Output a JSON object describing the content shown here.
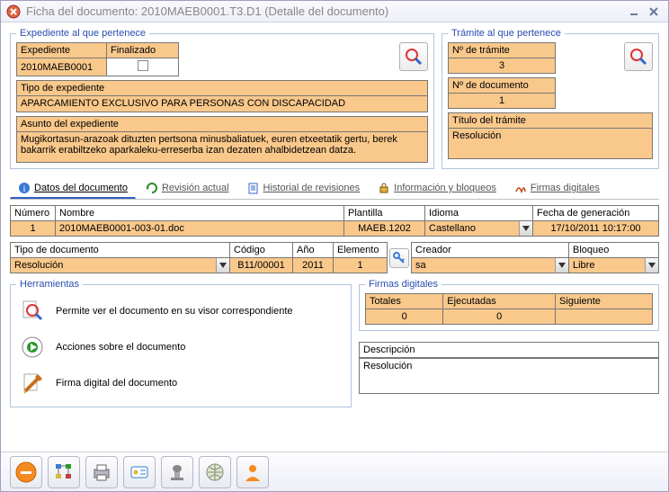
{
  "window": {
    "title": "Ficha del documento: 2010MAEB0001.T3.D1 (Detalle del documento)"
  },
  "expediente": {
    "legend": "Expediente al que pertenece",
    "expediente_label": "Expediente",
    "expediente_value": "2010MAEB0001",
    "finalizado_label": "Finalizado",
    "tipo_label": "Tipo de expediente",
    "tipo_value": "APARCAMIENTO EXCLUSIVO PARA PERSONAS CON DISCAPACIDAD",
    "asunto_label": "Asunto del expediente",
    "asunto_value": "Mugikortasun-arazoak dituzten pertsona minusbaliatuek, euren etxeetatik gertu, berek bakarrik erabiltzeko aparkaleku-erreserba izan dezaten ahalbidetzean datza."
  },
  "tramite": {
    "legend": "Trámite al que pertenece",
    "num_tramite_label": "Nº de trámite",
    "num_tramite_value": "3",
    "num_doc_label": "Nº de documento",
    "num_doc_value": "1",
    "titulo_label": "Título del trámite",
    "titulo_value": "Resolución"
  },
  "tabs": {
    "t1": "Datos del documento",
    "t2": "Revisión actual",
    "t3": "Historial de revisiones",
    "t4": "Información y bloqueos",
    "t5": "Firmas digitales"
  },
  "doc_grid1": {
    "h_numero": "Número",
    "h_nombre": "Nombre",
    "h_plantilla": "Plantilla",
    "h_idioma": "Idioma",
    "h_fecha": "Fecha de generación",
    "v_numero": "1",
    "v_nombre": "2010MAEB0001-003-01.doc",
    "v_plantilla": "MAEB.1202",
    "v_idioma": "Castellano",
    "v_fecha": "17/10/2011 10:17:00"
  },
  "doc_grid2a": {
    "h_tipo": "Tipo de documento",
    "h_codigo": "Código",
    "h_anio": "Año",
    "h_elemento": "Elemento",
    "v_tipo": "Resolución",
    "v_codigo": "B11/00001",
    "v_anio": "2011",
    "v_elemento": "1"
  },
  "doc_grid2b": {
    "h_creador": "Creador",
    "h_bloqueo": "Bloqueo",
    "v_creador": "sa",
    "v_bloqueo": "Libre"
  },
  "herramientas": {
    "legend": "Herramientas",
    "t1": "Permite ver el documento en su visor correspondiente",
    "t2": "Acciones sobre el documento",
    "t3": "Firma digital del documento"
  },
  "firmas": {
    "legend": "Firmas digitales",
    "h_totales": "Totales",
    "h_ejecutadas": "Ejecutadas",
    "h_siguiente": "Siguiente",
    "v_totales": "0",
    "v_ejecutadas": "0",
    "v_siguiente": ""
  },
  "descripcion": {
    "label": "Descripción",
    "value": "Resolución"
  }
}
